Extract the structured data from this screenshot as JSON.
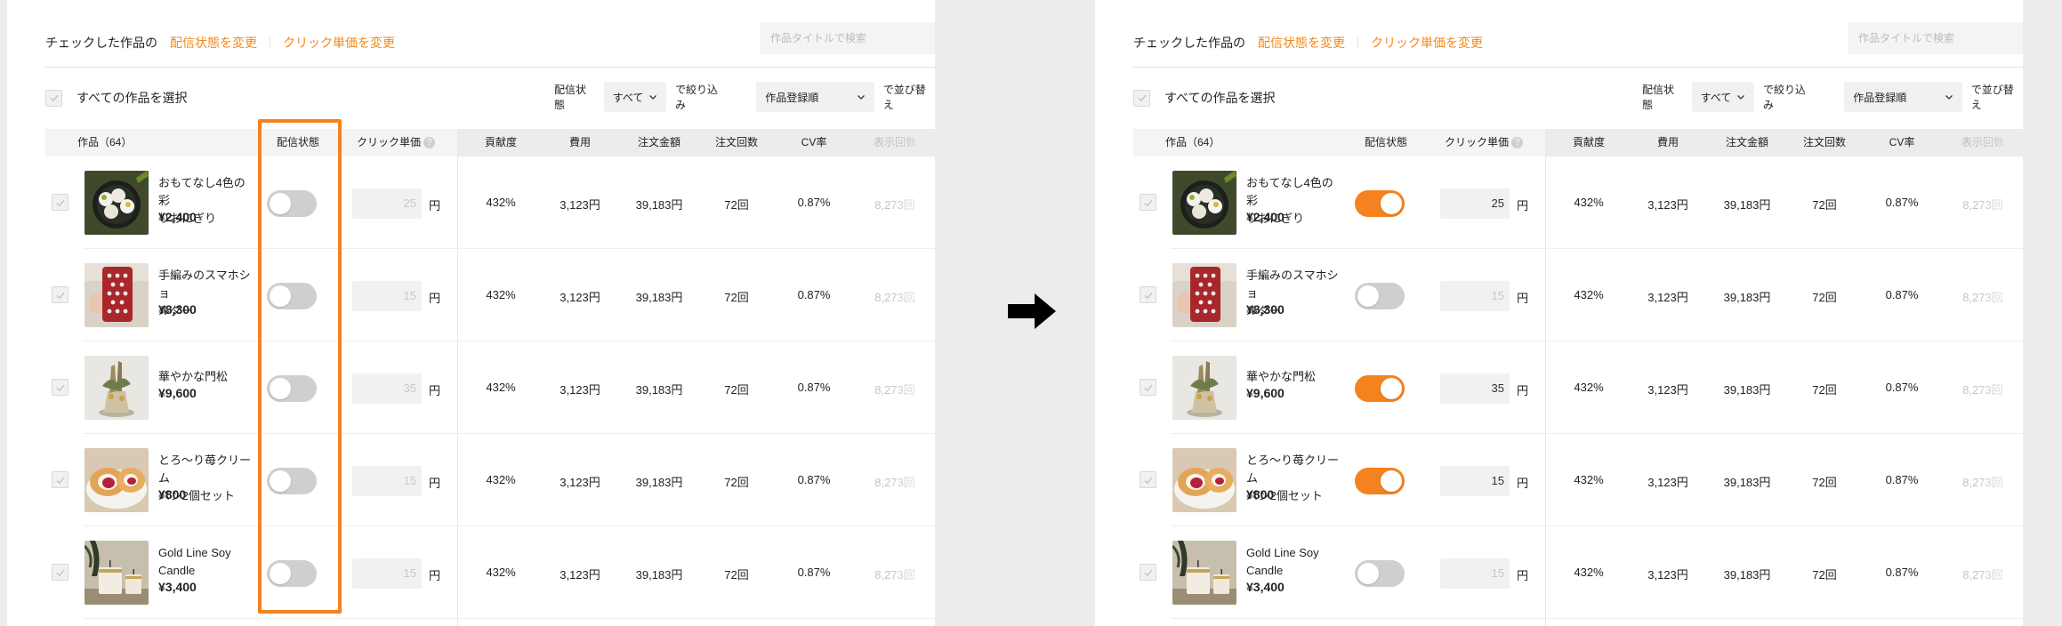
{
  "toolbar": {
    "checked_label": "チェックした作品の",
    "change_status": "配信状態を変更",
    "change_cpc": "クリック単価を変更"
  },
  "search": {
    "placeholder": "作品タイトルで検索"
  },
  "select_all": "すべての作品を選択",
  "filter": {
    "label": "配信状態",
    "value": "すべて",
    "suffix": "で絞り込み"
  },
  "sort": {
    "value": "作品登録順",
    "suffix": "で並び替え"
  },
  "headers": {
    "product": "作品（64）",
    "status": "配信状態",
    "cpc": "クリック単価",
    "contribution": "貢献度",
    "cost": "費用",
    "order_amount": "注文金額",
    "order_count": "注文回数",
    "cv_rate": "CV率",
    "impressions": "表示回数"
  },
  "yen_unit": "円",
  "rows": [
    {
      "name_l1": "おもてなし4色の彩",
      "name_l2": "りおにぎり",
      "price": "¥2,400",
      "contribution": "432%",
      "cost": "3,123円",
      "order_amount": "39,183円",
      "order_count": "72回",
      "cv_rate": "0.87%",
      "impressions": "8,273回"
    },
    {
      "name_l1": "手編みのスマホショ",
      "name_l2": "ルダー",
      "price": "¥8,300",
      "contribution": "432%",
      "cost": "3,123円",
      "order_amount": "39,183円",
      "order_count": "72回",
      "cv_rate": "0.87%",
      "impressions": "8,273回"
    },
    {
      "name_l1": "華やかな門松",
      "name_l2": "",
      "price": "¥9,600",
      "contribution": "432%",
      "cost": "3,123円",
      "order_amount": "39,183円",
      "order_count": "72回",
      "cv_rate": "0.87%",
      "impressions": "8,273回"
    },
    {
      "name_l1": "とろ〜り苺クリーム",
      "name_l2": "パン2個セット",
      "price": "¥800",
      "contribution": "432%",
      "cost": "3,123円",
      "order_amount": "39,183円",
      "order_count": "72回",
      "cv_rate": "0.87%",
      "impressions": "8,273回"
    },
    {
      "name_l1": "Gold Line Soy",
      "name_l2": "Candle",
      "price": "¥3,400",
      "contribution": "432%",
      "cost": "3,123円",
      "order_amount": "39,183円",
      "order_count": "72回",
      "cv_rate": "0.87%",
      "impressions": "8,273回"
    }
  ],
  "before": {
    "cpc": [
      "25",
      "15",
      "35",
      "15",
      "15"
    ],
    "status_on": [
      false,
      false,
      false,
      false,
      false
    ]
  },
  "after": {
    "cpc": [
      "25",
      "15",
      "35",
      "15",
      "15"
    ],
    "status_on": [
      true,
      false,
      true,
      true,
      false
    ]
  },
  "colors": {
    "accent": "#f4821f",
    "link": "#f08a1f",
    "toggle_off": "#cfcfcf",
    "highlight_border": "#f4821f"
  },
  "icons": [
    "check-icon",
    "chevron-down-icon",
    "help-icon",
    "right-arrow-icon"
  ]
}
